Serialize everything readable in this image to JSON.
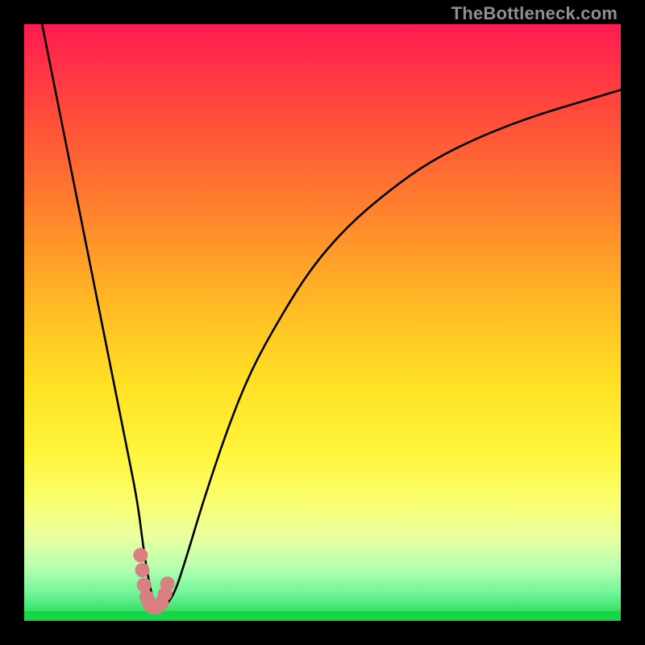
{
  "watermark": "TheBottleneck.com",
  "colors": {
    "black": "#000000",
    "curve": "#000000",
    "marker": "#d97f82",
    "green": "#18d548"
  },
  "chart_data": {
    "type": "line",
    "title": "",
    "xlabel": "",
    "ylabel": "",
    "xlim": [
      0,
      100
    ],
    "ylim": [
      0,
      100
    ],
    "series": [
      {
        "name": "bottleneck-curve",
        "x": [
          3,
          5,
          7,
          9,
          11,
          13,
          15,
          17,
          19,
          20,
          21,
          22,
          23,
          25,
          27,
          30,
          34,
          38,
          43,
          48,
          54,
          61,
          68,
          76,
          85,
          95,
          100
        ],
        "y": [
          100,
          90,
          80,
          70,
          60,
          50,
          40,
          30,
          20,
          12,
          6,
          2,
          2,
          4,
          10,
          20,
          32,
          42,
          51,
          59,
          66,
          72,
          77,
          81,
          84.5,
          87.5,
          89
        ]
      },
      {
        "name": "marker-cluster",
        "x": [
          19.5,
          19.8,
          20.1,
          20.5,
          21.0,
          21.6,
          22.3,
          23.0,
          23.6,
          24.0
        ],
        "y": [
          11.0,
          8.5,
          6.0,
          4.0,
          2.8,
          2.3,
          2.3,
          3.0,
          4.5,
          6.2
        ]
      }
    ],
    "gradient_stops": [
      {
        "offset": 0.0,
        "color": "#ff1a52"
      },
      {
        "offset": 0.05,
        "color": "#ff2b49"
      },
      {
        "offset": 0.15,
        "color": "#ff4b3b"
      },
      {
        "offset": 0.3,
        "color": "#ff7d2e"
      },
      {
        "offset": 0.45,
        "color": "#ffb325"
      },
      {
        "offset": 0.6,
        "color": "#ffe024"
      },
      {
        "offset": 0.72,
        "color": "#fff53c"
      },
      {
        "offset": 0.8,
        "color": "#faff6e"
      },
      {
        "offset": 0.86,
        "color": "#e9ffa0"
      },
      {
        "offset": 0.91,
        "color": "#b8ffb0"
      },
      {
        "offset": 0.955,
        "color": "#6ef598"
      },
      {
        "offset": 1.0,
        "color": "#18d548"
      }
    ]
  }
}
